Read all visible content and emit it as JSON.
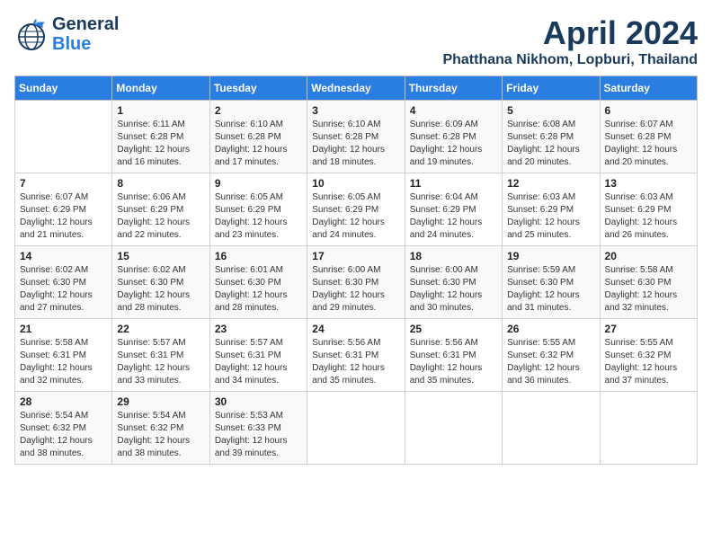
{
  "header": {
    "logo_line1": "General",
    "logo_line2": "Blue",
    "month": "April 2024",
    "location": "Phatthana Nikhom, Lopburi, Thailand"
  },
  "weekdays": [
    "Sunday",
    "Monday",
    "Tuesday",
    "Wednesday",
    "Thursday",
    "Friday",
    "Saturday"
  ],
  "weeks": [
    [
      {
        "day": "",
        "info": ""
      },
      {
        "day": "1",
        "info": "Sunrise: 6:11 AM\nSunset: 6:28 PM\nDaylight: 12 hours\nand 16 minutes."
      },
      {
        "day": "2",
        "info": "Sunrise: 6:10 AM\nSunset: 6:28 PM\nDaylight: 12 hours\nand 17 minutes."
      },
      {
        "day": "3",
        "info": "Sunrise: 6:10 AM\nSunset: 6:28 PM\nDaylight: 12 hours\nand 18 minutes."
      },
      {
        "day": "4",
        "info": "Sunrise: 6:09 AM\nSunset: 6:28 PM\nDaylight: 12 hours\nand 19 minutes."
      },
      {
        "day": "5",
        "info": "Sunrise: 6:08 AM\nSunset: 6:28 PM\nDaylight: 12 hours\nand 20 minutes."
      },
      {
        "day": "6",
        "info": "Sunrise: 6:07 AM\nSunset: 6:28 PM\nDaylight: 12 hours\nand 20 minutes."
      }
    ],
    [
      {
        "day": "7",
        "info": "Sunrise: 6:07 AM\nSunset: 6:29 PM\nDaylight: 12 hours\nand 21 minutes."
      },
      {
        "day": "8",
        "info": "Sunrise: 6:06 AM\nSunset: 6:29 PM\nDaylight: 12 hours\nand 22 minutes."
      },
      {
        "day": "9",
        "info": "Sunrise: 6:05 AM\nSunset: 6:29 PM\nDaylight: 12 hours\nand 23 minutes."
      },
      {
        "day": "10",
        "info": "Sunrise: 6:05 AM\nSunset: 6:29 PM\nDaylight: 12 hours\nand 24 minutes."
      },
      {
        "day": "11",
        "info": "Sunrise: 6:04 AM\nSunset: 6:29 PM\nDaylight: 12 hours\nand 24 minutes."
      },
      {
        "day": "12",
        "info": "Sunrise: 6:03 AM\nSunset: 6:29 PM\nDaylight: 12 hours\nand 25 minutes."
      },
      {
        "day": "13",
        "info": "Sunrise: 6:03 AM\nSunset: 6:29 PM\nDaylight: 12 hours\nand 26 minutes."
      }
    ],
    [
      {
        "day": "14",
        "info": "Sunrise: 6:02 AM\nSunset: 6:30 PM\nDaylight: 12 hours\nand 27 minutes."
      },
      {
        "day": "15",
        "info": "Sunrise: 6:02 AM\nSunset: 6:30 PM\nDaylight: 12 hours\nand 28 minutes."
      },
      {
        "day": "16",
        "info": "Sunrise: 6:01 AM\nSunset: 6:30 PM\nDaylight: 12 hours\nand 28 minutes."
      },
      {
        "day": "17",
        "info": "Sunrise: 6:00 AM\nSunset: 6:30 PM\nDaylight: 12 hours\nand 29 minutes."
      },
      {
        "day": "18",
        "info": "Sunrise: 6:00 AM\nSunset: 6:30 PM\nDaylight: 12 hours\nand 30 minutes."
      },
      {
        "day": "19",
        "info": "Sunrise: 5:59 AM\nSunset: 6:30 PM\nDaylight: 12 hours\nand 31 minutes."
      },
      {
        "day": "20",
        "info": "Sunrise: 5:58 AM\nSunset: 6:30 PM\nDaylight: 12 hours\nand 32 minutes."
      }
    ],
    [
      {
        "day": "21",
        "info": "Sunrise: 5:58 AM\nSunset: 6:31 PM\nDaylight: 12 hours\nand 32 minutes."
      },
      {
        "day": "22",
        "info": "Sunrise: 5:57 AM\nSunset: 6:31 PM\nDaylight: 12 hours\nand 33 minutes."
      },
      {
        "day": "23",
        "info": "Sunrise: 5:57 AM\nSunset: 6:31 PM\nDaylight: 12 hours\nand 34 minutes."
      },
      {
        "day": "24",
        "info": "Sunrise: 5:56 AM\nSunset: 6:31 PM\nDaylight: 12 hours\nand 35 minutes."
      },
      {
        "day": "25",
        "info": "Sunrise: 5:56 AM\nSunset: 6:31 PM\nDaylight: 12 hours\nand 35 minutes."
      },
      {
        "day": "26",
        "info": "Sunrise: 5:55 AM\nSunset: 6:32 PM\nDaylight: 12 hours\nand 36 minutes."
      },
      {
        "day": "27",
        "info": "Sunrise: 5:55 AM\nSunset: 6:32 PM\nDaylight: 12 hours\nand 37 minutes."
      }
    ],
    [
      {
        "day": "28",
        "info": "Sunrise: 5:54 AM\nSunset: 6:32 PM\nDaylight: 12 hours\nand 38 minutes."
      },
      {
        "day": "29",
        "info": "Sunrise: 5:54 AM\nSunset: 6:32 PM\nDaylight: 12 hours\nand 38 minutes."
      },
      {
        "day": "30",
        "info": "Sunrise: 5:53 AM\nSunset: 6:33 PM\nDaylight: 12 hours\nand 39 minutes."
      },
      {
        "day": "",
        "info": ""
      },
      {
        "day": "",
        "info": ""
      },
      {
        "day": "",
        "info": ""
      },
      {
        "day": "",
        "info": ""
      }
    ]
  ]
}
